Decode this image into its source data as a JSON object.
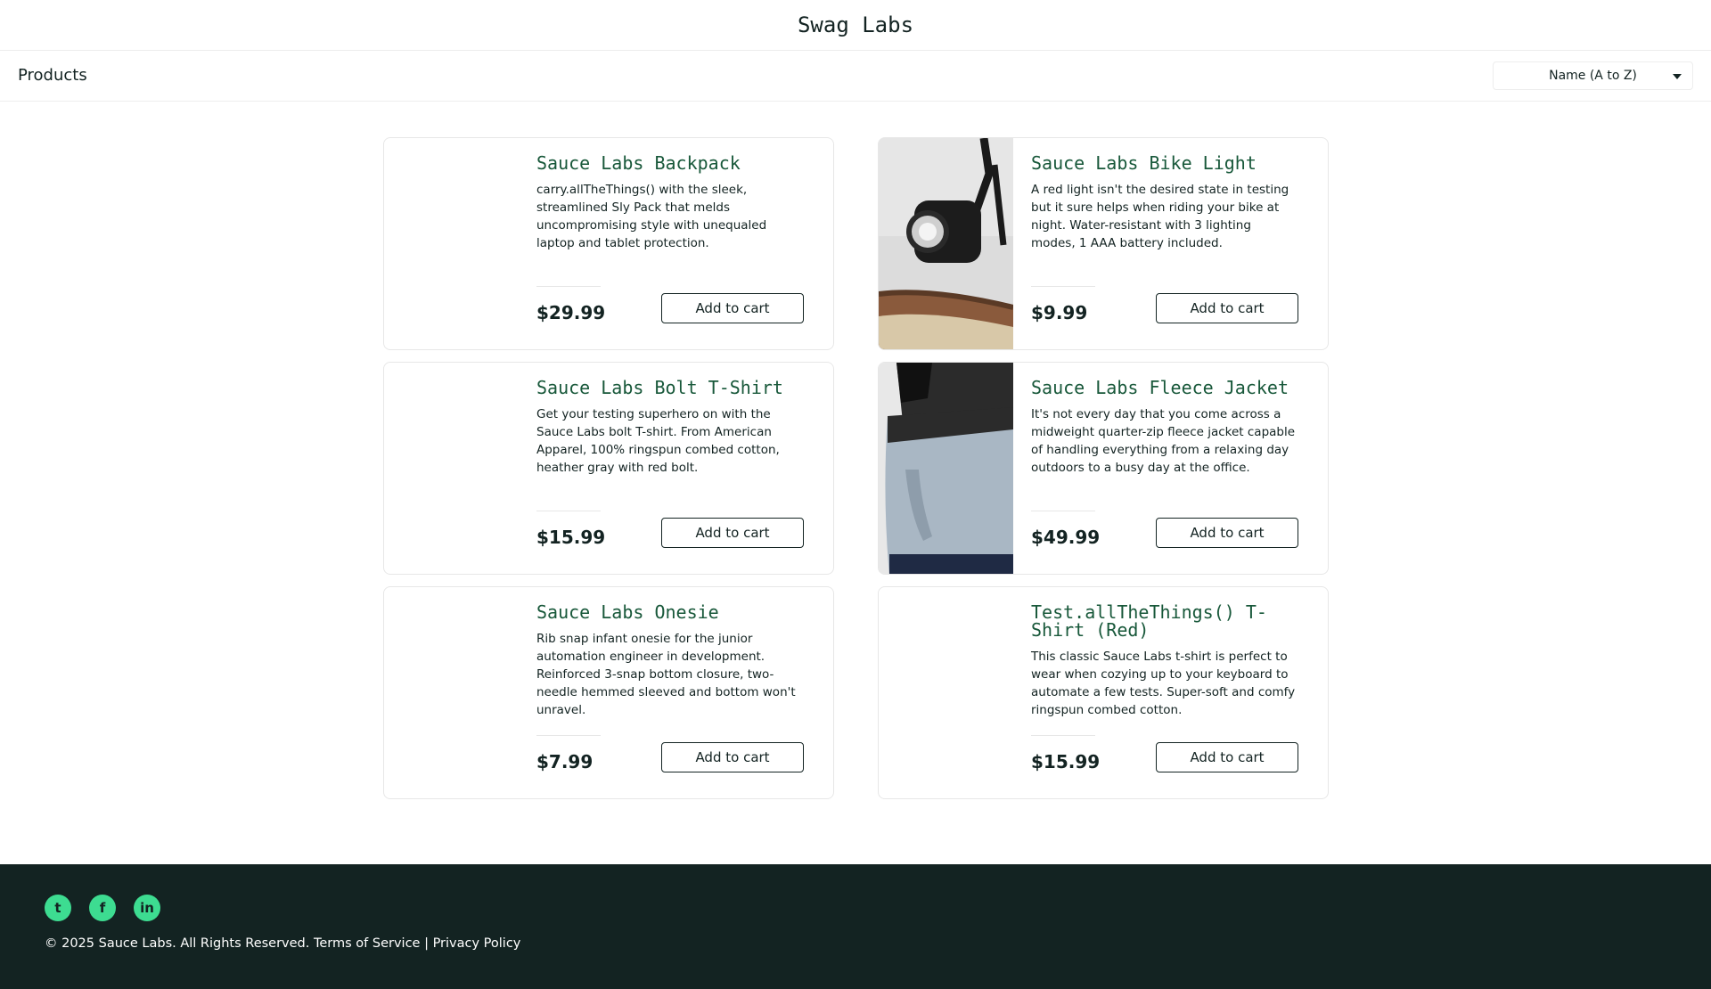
{
  "header": {
    "title": "Swag Labs"
  },
  "subheader": {
    "title": "Products",
    "sort_value": "Name (A to Z)"
  },
  "products": [
    {
      "name": "Sauce Labs Backpack",
      "description": "carry.allTheThings() with the sleek, streamlined Sly Pack that melds uncompromising style with unequaled laptop and tablet protection.",
      "price": "$29.99",
      "button": "Add to cart",
      "image": "none"
    },
    {
      "name": "Sauce Labs Bike Light",
      "description": "A red light isn't the desired state in testing but it sure helps when riding your bike at night. Water-resistant with 3 lighting modes, 1 AAA battery included.",
      "price": "$9.99",
      "button": "Add to cart",
      "image": "bike-light"
    },
    {
      "name": "Sauce Labs Bolt T-Shirt",
      "description": "Get your testing superhero on with the Sauce Labs bolt T-shirt. From American Apparel, 100% ringspun combed cotton, heather gray with red bolt.",
      "price": "$15.99",
      "button": "Add to cart",
      "image": "none"
    },
    {
      "name": "Sauce Labs Fleece Jacket",
      "description": "It's not every day that you come across a midweight quarter-zip fleece jacket capable of handling everything from a relaxing day outdoors to a busy day at the office.",
      "price": "$49.99",
      "button": "Add to cart",
      "image": "fleece-jacket"
    },
    {
      "name": "Sauce Labs Onesie",
      "description": "Rib snap infant onesie for the junior automation engineer in development. Reinforced 3-snap bottom closure, two-needle hemmed sleeved and bottom won't unravel.",
      "price": "$7.99",
      "button": "Add to cart",
      "image": "none"
    },
    {
      "name": "Test.allTheThings() T-Shirt (Red)",
      "description": "This classic Sauce Labs t-shirt is perfect to wear when cozying up to your keyboard to automate a few tests. Super-soft and comfy ringspun combed cotton.",
      "price": "$15.99",
      "button": "Add to cart",
      "image": "none"
    }
  ],
  "footer": {
    "social": [
      {
        "name": "twitter-icon",
        "glyph": "t"
      },
      {
        "name": "facebook-icon",
        "glyph": "f"
      },
      {
        "name": "linkedin-icon",
        "glyph": "in"
      }
    ],
    "copyright": "© 2025 Sauce Labs. All Rights Reserved. Terms of Service | Privacy Policy"
  },
  "colors": {
    "footer_bg": "#132322",
    "accent": "#3ddc91",
    "item_name": "#18583a"
  }
}
